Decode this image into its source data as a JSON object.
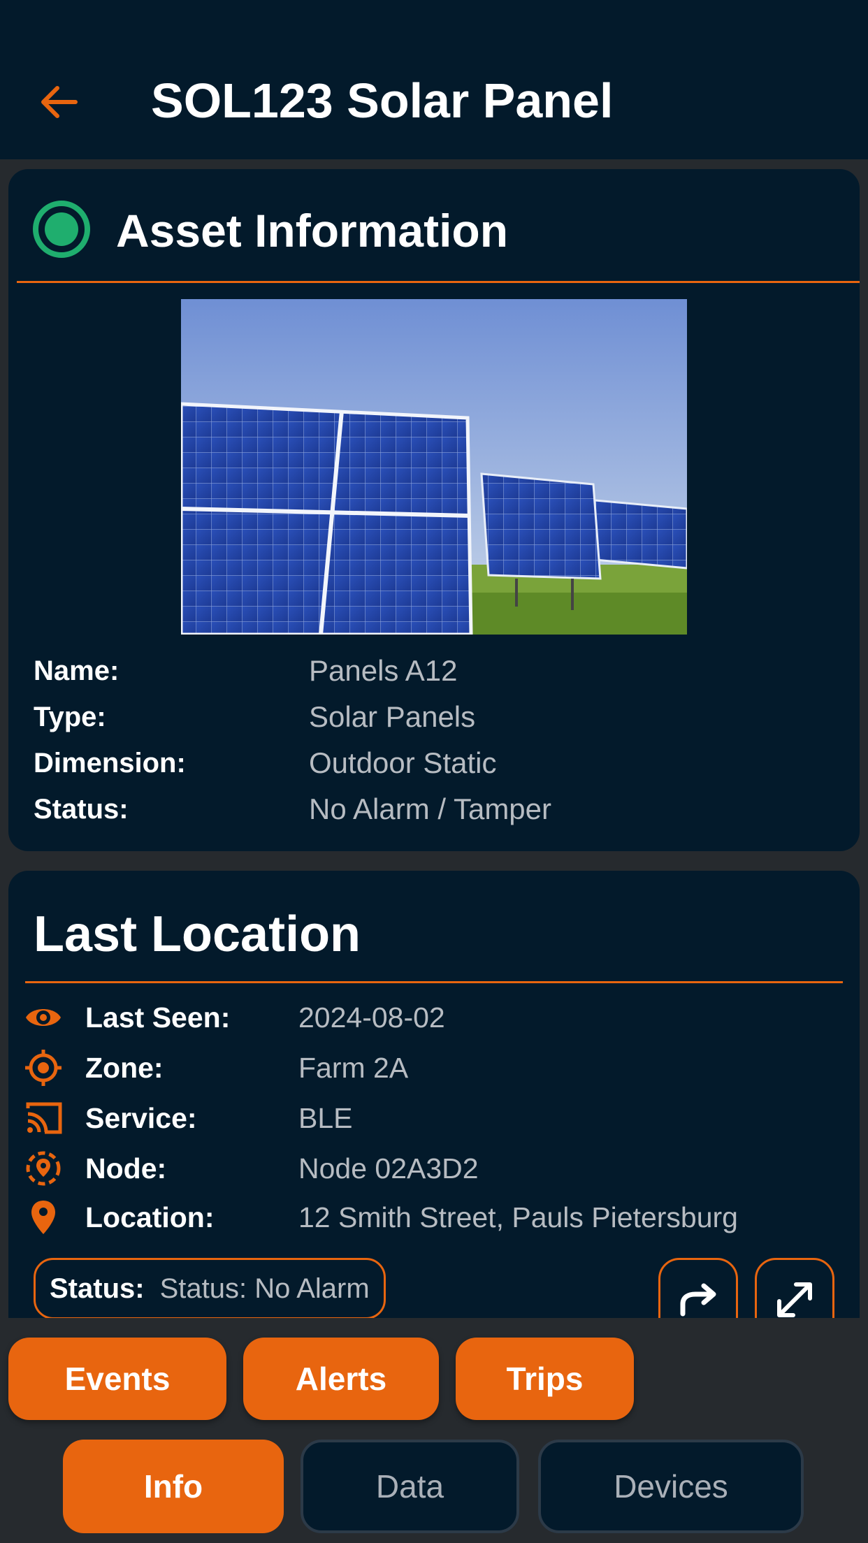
{
  "header": {
    "title": "SOL123 Solar Panel",
    "back_icon": "arrow-left-icon"
  },
  "colors": {
    "accent": "#e8650f",
    "background": "#031a2b",
    "status_ok": "#1fae6e"
  },
  "asset_info": {
    "title": "Asset Information",
    "status_icon": "status-dot-icon",
    "image_subject": "solar-panels-image",
    "fields": [
      {
        "label": "Name:",
        "value": "Panels A12"
      },
      {
        "label": "Type:",
        "value": "Solar Panels"
      },
      {
        "label": "Dimension:",
        "value": "Outdoor Static"
      },
      {
        "label": "Status:",
        "value": "No Alarm / Tamper"
      }
    ]
  },
  "last_location": {
    "title": "Last Location",
    "fields": [
      {
        "icon": "eye-icon",
        "label": "Last Seen:",
        "value": "2024-08-02"
      },
      {
        "icon": "crosshair-icon",
        "label": "Zone:",
        "value": "Farm 2A"
      },
      {
        "icon": "cast-icon",
        "label": "Service:",
        "value": "BLE"
      },
      {
        "icon": "location-dashed-icon",
        "label": "Node:",
        "value": "Node 02A3D2"
      },
      {
        "icon": "map-pin-icon",
        "label": "Location:",
        "value": "12 Smith Street, Pauls Pietersburg"
      }
    ],
    "status_label": "Status:",
    "status_value": "Status: No Alarm",
    "share_icon": "share-icon",
    "expand_icon": "expand-icon"
  },
  "actions": [
    {
      "label": "Events"
    },
    {
      "label": "Alerts"
    },
    {
      "label": "Trips"
    }
  ],
  "tabs": [
    {
      "label": "Info",
      "active": true
    },
    {
      "label": "Data",
      "active": false
    },
    {
      "label": "Devices",
      "active": false
    }
  ]
}
